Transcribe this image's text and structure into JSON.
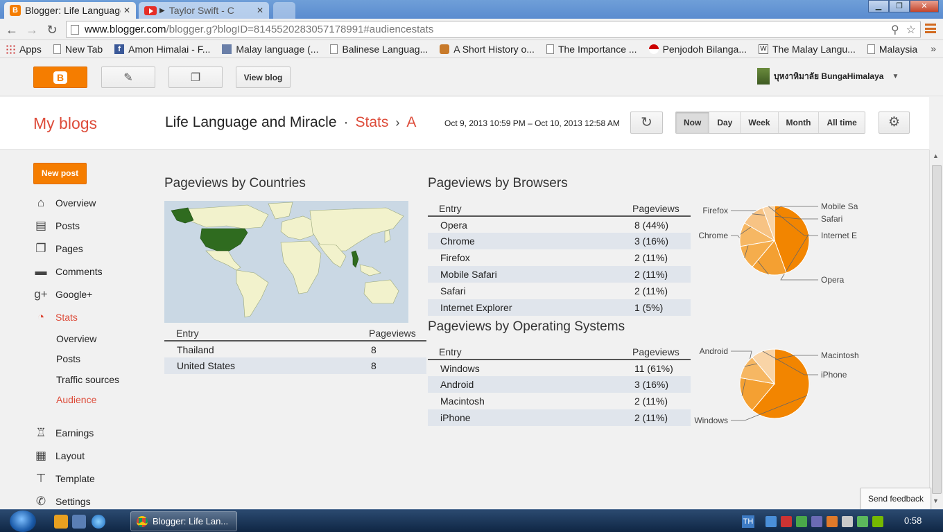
{
  "browser": {
    "tabs": [
      {
        "title": "Blogger: Life Language",
        "active": true
      },
      {
        "title": "Taylor Swift - C",
        "active": false
      }
    ],
    "url_host": "www.blogger.com",
    "url_rest": "/blogger.g?blogID=8145520283057178991#audiencestats",
    "bookmarks": [
      {
        "label": "Apps",
        "icon": "apps-grid-icon"
      },
      {
        "label": "New Tab",
        "icon": "page-icon"
      },
      {
        "label": "Amon Himalai - F...",
        "icon": "facebook-icon"
      },
      {
        "label": "Malay language (...",
        "icon": "image-icon"
      },
      {
        "label": "Balinese Languag...",
        "icon": "page-icon"
      },
      {
        "label": "A Short History o...",
        "icon": "cat-icon"
      },
      {
        "label": "The Importance ...",
        "icon": "page-icon"
      },
      {
        "label": "Penjodoh Bilanga...",
        "icon": "flag-icon"
      },
      {
        "label": "The Malay Langu...",
        "icon": "wikipedia-icon"
      },
      {
        "label": "Malaysia",
        "icon": "page-icon"
      }
    ],
    "more_chevron": "»"
  },
  "header": {
    "view_blog": "View blog",
    "user_name": "บุหงาหิมาลัย BungaHimalaya"
  },
  "titlebar": {
    "my_blogs": "My blogs",
    "blog_name": "Life Language and Miracle",
    "separator": "·",
    "stats": "Stats",
    "arrow": "›",
    "audience_initial": "A",
    "date_range": "Oct 9, 2013 10:59 PM – Oct 10, 2013 12:58 AM",
    "periods": [
      {
        "label": "Now",
        "selected": true
      },
      {
        "label": "Day",
        "selected": false
      },
      {
        "label": "Week",
        "selected": false
      },
      {
        "label": "Month",
        "selected": false
      },
      {
        "label": "All time",
        "selected": false
      }
    ]
  },
  "sidebar": {
    "new_post": "New post",
    "items": [
      {
        "label": "Overview",
        "icon": "home-icon"
      },
      {
        "label": "Posts",
        "icon": "posts-icon"
      },
      {
        "label": "Pages",
        "icon": "pages-icon"
      },
      {
        "label": "Comments",
        "icon": "comment-icon"
      },
      {
        "label": "Google+",
        "icon": "google-plus-icon"
      },
      {
        "label": "Stats",
        "icon": "stats-pie-icon",
        "active": true
      }
    ],
    "stats_sub": [
      {
        "label": "Overview"
      },
      {
        "label": "Posts"
      },
      {
        "label": "Traffic sources"
      },
      {
        "label": "Audience",
        "active": true
      }
    ],
    "items2": [
      {
        "label": "Earnings",
        "icon": "trophy-icon"
      },
      {
        "label": "Layout",
        "icon": "layout-icon"
      },
      {
        "label": "Template",
        "icon": "paint-roller-icon"
      },
      {
        "label": "Settings",
        "icon": "wrench-icon"
      }
    ]
  },
  "countries": {
    "title": "Pageviews by Countries",
    "col_entry": "Entry",
    "col_pageviews": "Pageviews",
    "rows": [
      {
        "entry": "Thailand",
        "pageviews": "8"
      },
      {
        "entry": "United States",
        "pageviews": "8"
      }
    ],
    "highlight_color": "#2f6b1f"
  },
  "browsers": {
    "title": "Pageviews by Browsers",
    "col_entry": "Entry",
    "col_pageviews": "Pageviews",
    "rows": [
      {
        "entry": "Opera",
        "pageviews": "8 (44%)"
      },
      {
        "entry": "Chrome",
        "pageviews": "3 (16%)"
      },
      {
        "entry": "Firefox",
        "pageviews": "2 (11%)"
      },
      {
        "entry": "Mobile Safari",
        "pageviews": "2 (11%)"
      },
      {
        "entry": "Safari",
        "pageviews": "2 (11%)"
      },
      {
        "entry": "Internet Explorer",
        "pageviews": "1 (5%)"
      }
    ]
  },
  "os": {
    "title": "Pageviews by Operating Systems",
    "col_entry": "Entry",
    "col_pageviews": "Pageviews",
    "rows": [
      {
        "entry": "Windows",
        "pageviews": "11 (61%)"
      },
      {
        "entry": "Android",
        "pageviews": "3 (16%)"
      },
      {
        "entry": "Macintosh",
        "pageviews": "2 (11%)"
      },
      {
        "entry": "iPhone",
        "pageviews": "2 (11%)"
      }
    ]
  },
  "chart_data": [
    {
      "type": "pie",
      "title": "",
      "categories": [
        "Opera",
        "Chrome",
        "Firefox",
        "Mobile Sa",
        "Safari",
        "Internet E"
      ],
      "values": [
        8,
        3,
        2,
        2,
        2,
        1
      ],
      "colors": [
        "#f28500",
        "#f4a032",
        "#f5ad4c",
        "#f6b763",
        "#f7c384",
        "#f9d4a6"
      ]
    },
    {
      "type": "pie",
      "title": "",
      "categories": [
        "Windows",
        "Android",
        "Macintosh",
        "iPhone"
      ],
      "values": [
        11,
        3,
        2,
        2
      ],
      "colors": [
        "#f28500",
        "#f4a032",
        "#f6b763",
        "#f9d4a6"
      ]
    }
  ],
  "feedback": "Send feedback",
  "taskbar": {
    "task_label": "Blogger: Life Lan...",
    "language": "TH",
    "clock": "0:58"
  }
}
